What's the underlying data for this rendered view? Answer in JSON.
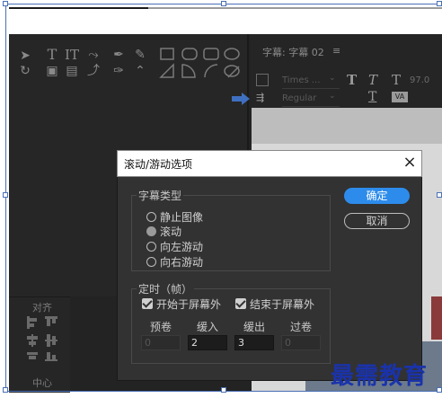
{
  "panel": {
    "title": "字幕: 字幕 02",
    "menu_icon": "≡",
    "font_name": "Times ...",
    "font_style": "Regular",
    "font_size": "97.0",
    "align_label": "对齐",
    "center_label": "中心"
  },
  "dialog": {
    "title": "滚动/游动选项",
    "subtitle_type_label": "字幕类型",
    "types": [
      {
        "label": "静止图像",
        "selected": false
      },
      {
        "label": "滚动",
        "selected": true
      },
      {
        "label": "向左游动",
        "selected": false
      },
      {
        "label": "向右游动",
        "selected": false
      }
    ],
    "timing_label": "定时（帧）",
    "start_offscreen": "开始于屏幕外",
    "end_offscreen": "结束于屏幕外",
    "columns": [
      {
        "label": "预卷",
        "value": "0",
        "enabled": false
      },
      {
        "label": "缓入",
        "value": "2",
        "enabled": true
      },
      {
        "label": "缓出",
        "value": "3",
        "enabled": true
      },
      {
        "label": "过卷",
        "value": "0",
        "enabled": false
      }
    ],
    "ok": "确定",
    "cancel": "取消"
  },
  "watermark": "最需教育",
  "colors": {
    "accent": "#2d8ceb",
    "dialog_bg": "#323232",
    "watermark": "#1a33aa"
  }
}
